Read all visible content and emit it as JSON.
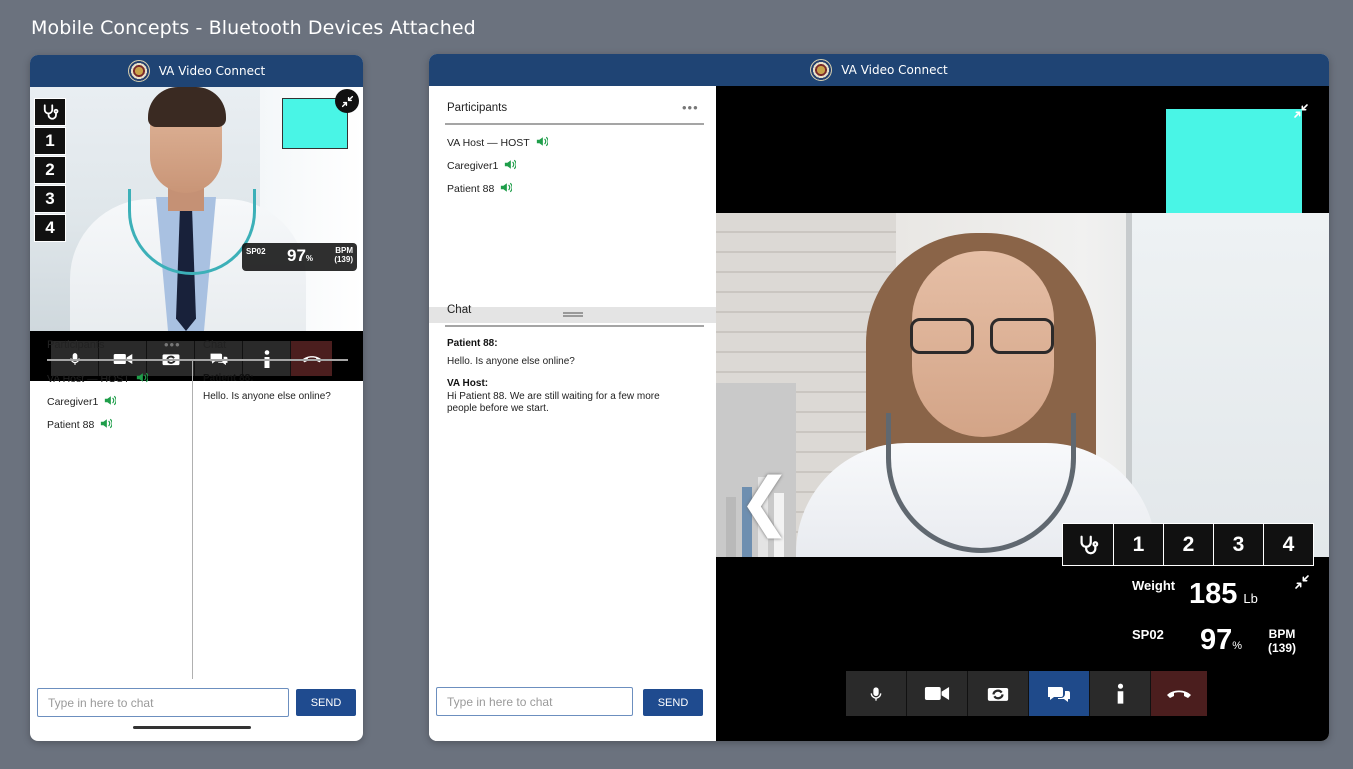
{
  "page": {
    "title": "Mobile Concepts - Bluetooth Devices Attached"
  },
  "app": {
    "name": "VA Video Connect"
  },
  "vitals_tabs": [
    "1",
    "2",
    "3",
    "4"
  ],
  "participants": {
    "title": "Participants",
    "menu": "•••",
    "list": [
      {
        "name": "VA Host — HOST"
      },
      {
        "name": "Caregiver1"
      },
      {
        "name": "Patient 88"
      }
    ]
  },
  "chat": {
    "title": "Chat",
    "messages": [
      {
        "sender": "Patient 88:",
        "text": "Hello. Is anyone else online?"
      },
      {
        "sender": "VA Host:",
        "text": "Hi Patient 88. We are still waiting for a few more people before we start."
      }
    ],
    "input_placeholder": "Type in here to chat",
    "send_label": "SEND"
  },
  "vitals": {
    "spo2_label": "SP02",
    "spo2_value": "97",
    "spo2_unit": "%",
    "bpm_label": "BPM",
    "bpm_value": "(139)",
    "weight_label": "Weight",
    "weight_value": "185",
    "weight_unit": "Lb"
  },
  "icons": {
    "stethoscope": "stethoscope-icon",
    "mic": "microphone-icon",
    "camera": "video-camera-icon",
    "switch": "switch-camera-icon",
    "chat": "chat-bubbles-icon",
    "info": "info-icon",
    "end": "end-call-icon",
    "collapse": "collapse-icon",
    "back": "chevron-left-icon"
  },
  "colors": {
    "header": "#1f4474",
    "send": "#1f4b8f",
    "pip": "#49f5e6",
    "end_call": "#4b1e1e",
    "active_control": "#1f4a8a",
    "speaking": "#1f9e4a"
  }
}
